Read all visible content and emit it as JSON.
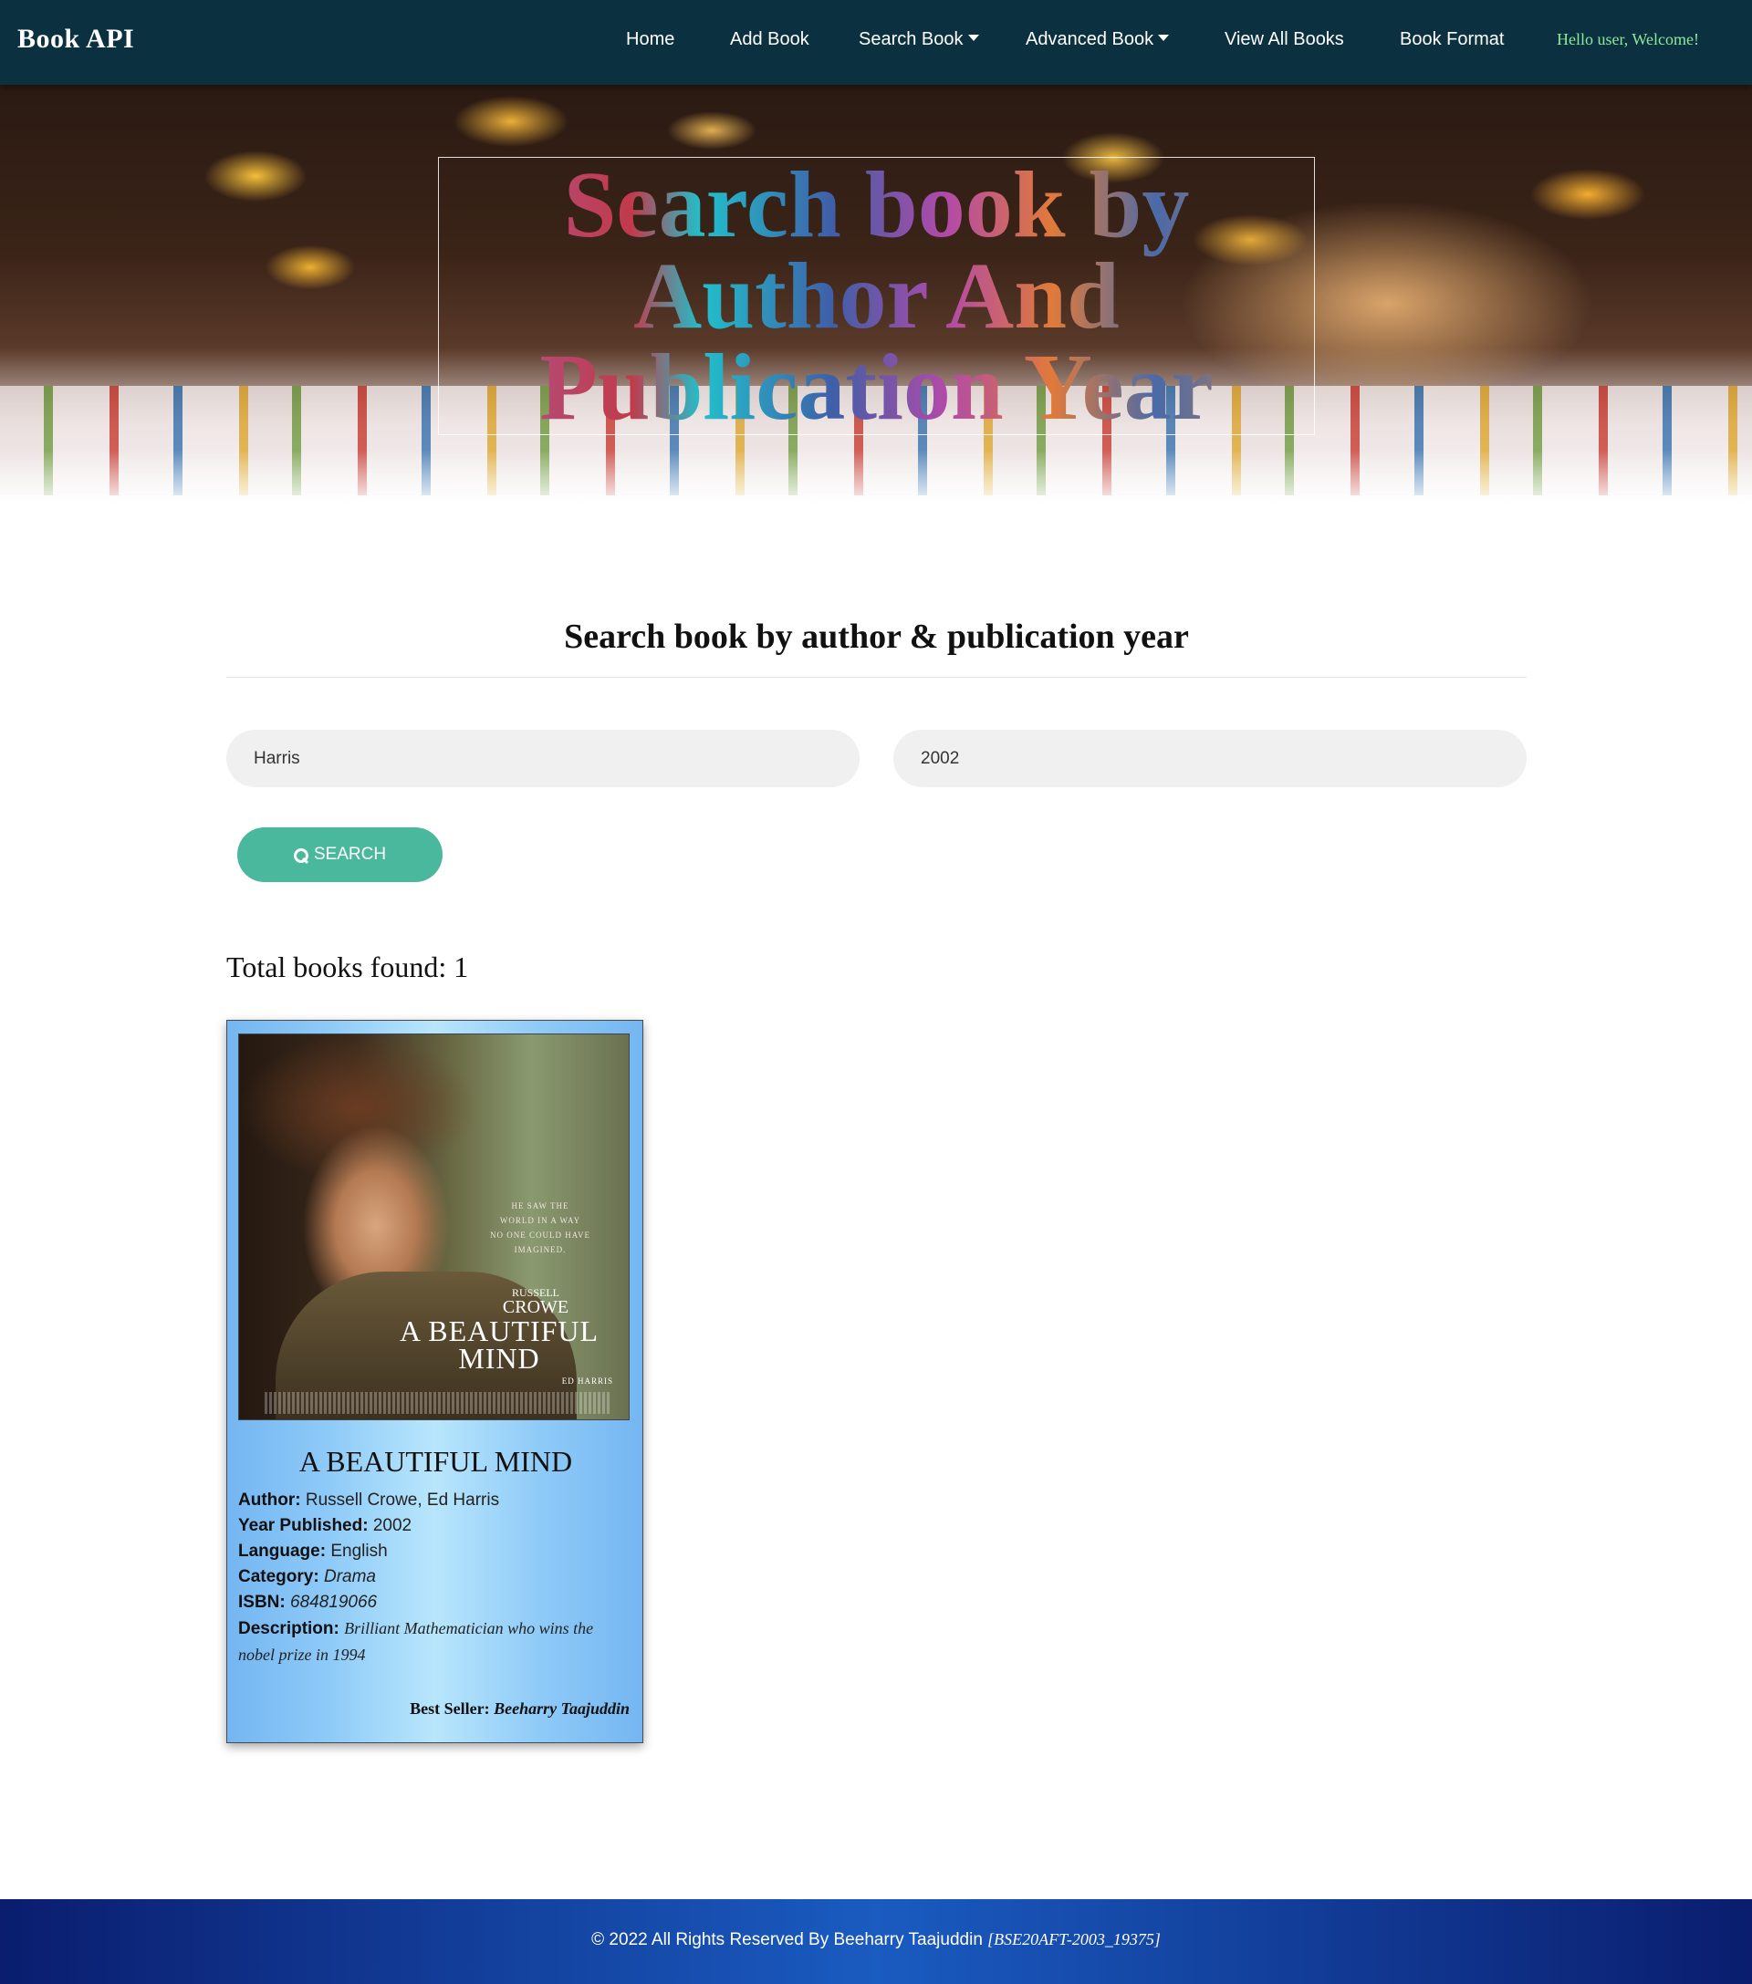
{
  "navbar": {
    "brand": "Book API",
    "items": [
      {
        "label": "Home"
      },
      {
        "label": "Add Book"
      },
      {
        "label": "Search Book"
      },
      {
        "label": "Advanced Book"
      },
      {
        "label": "View All Books"
      },
      {
        "label": "Book Format"
      }
    ],
    "welcome": "Hello user, Welcome!"
  },
  "hero": {
    "title_lines": [
      "Search book by",
      "Author And",
      "Publication Year"
    ]
  },
  "search": {
    "heading": "Search book by author & publication year",
    "author_value": "Harris",
    "year_value": "2002",
    "button_label": "SEARCH"
  },
  "results": {
    "total_text": "Total books found: 1",
    "books": [
      {
        "poster": {
          "tagline": [
            "HE SAW THE",
            "WORLD IN A WAY",
            "NO ONE COULD HAVE",
            "IMAGINED."
          ],
          "actor_first": "RUSSELL",
          "actor_last": "CROWE",
          "title_line1": "A BEAUTIFUL",
          "title_line2": "MIND",
          "costar": "ED HARRIS"
        },
        "title": "A BEAUTIFUL MIND",
        "author_label": "Author:",
        "author": "Russell Crowe, Ed Harris",
        "year_label": "Year Published:",
        "year": "2002",
        "language_label": "Language:",
        "language": "English",
        "category_label": "Category:",
        "category": "Drama",
        "isbn_label": "ISBN:",
        "isbn": "684819066",
        "description_label": "Description:",
        "description": "Brilliant Mathematician who wins the nobel prize in 1994",
        "seller_label": "Best Seller:",
        "seller": "Beeharry Taajuddin"
      }
    ]
  },
  "footer": {
    "text": "© 2022 All Rights Reserved By Beeharry Taajuddin",
    "code": "[BSE20AFT-2003_19375]"
  },
  "colors": {
    "navbar_bg": "#0b3040",
    "welcome_text": "#8fe89a",
    "search_button": "#4ab89c",
    "input_bg": "#f0f0f0",
    "footer_bg": "#1a5bc0"
  }
}
